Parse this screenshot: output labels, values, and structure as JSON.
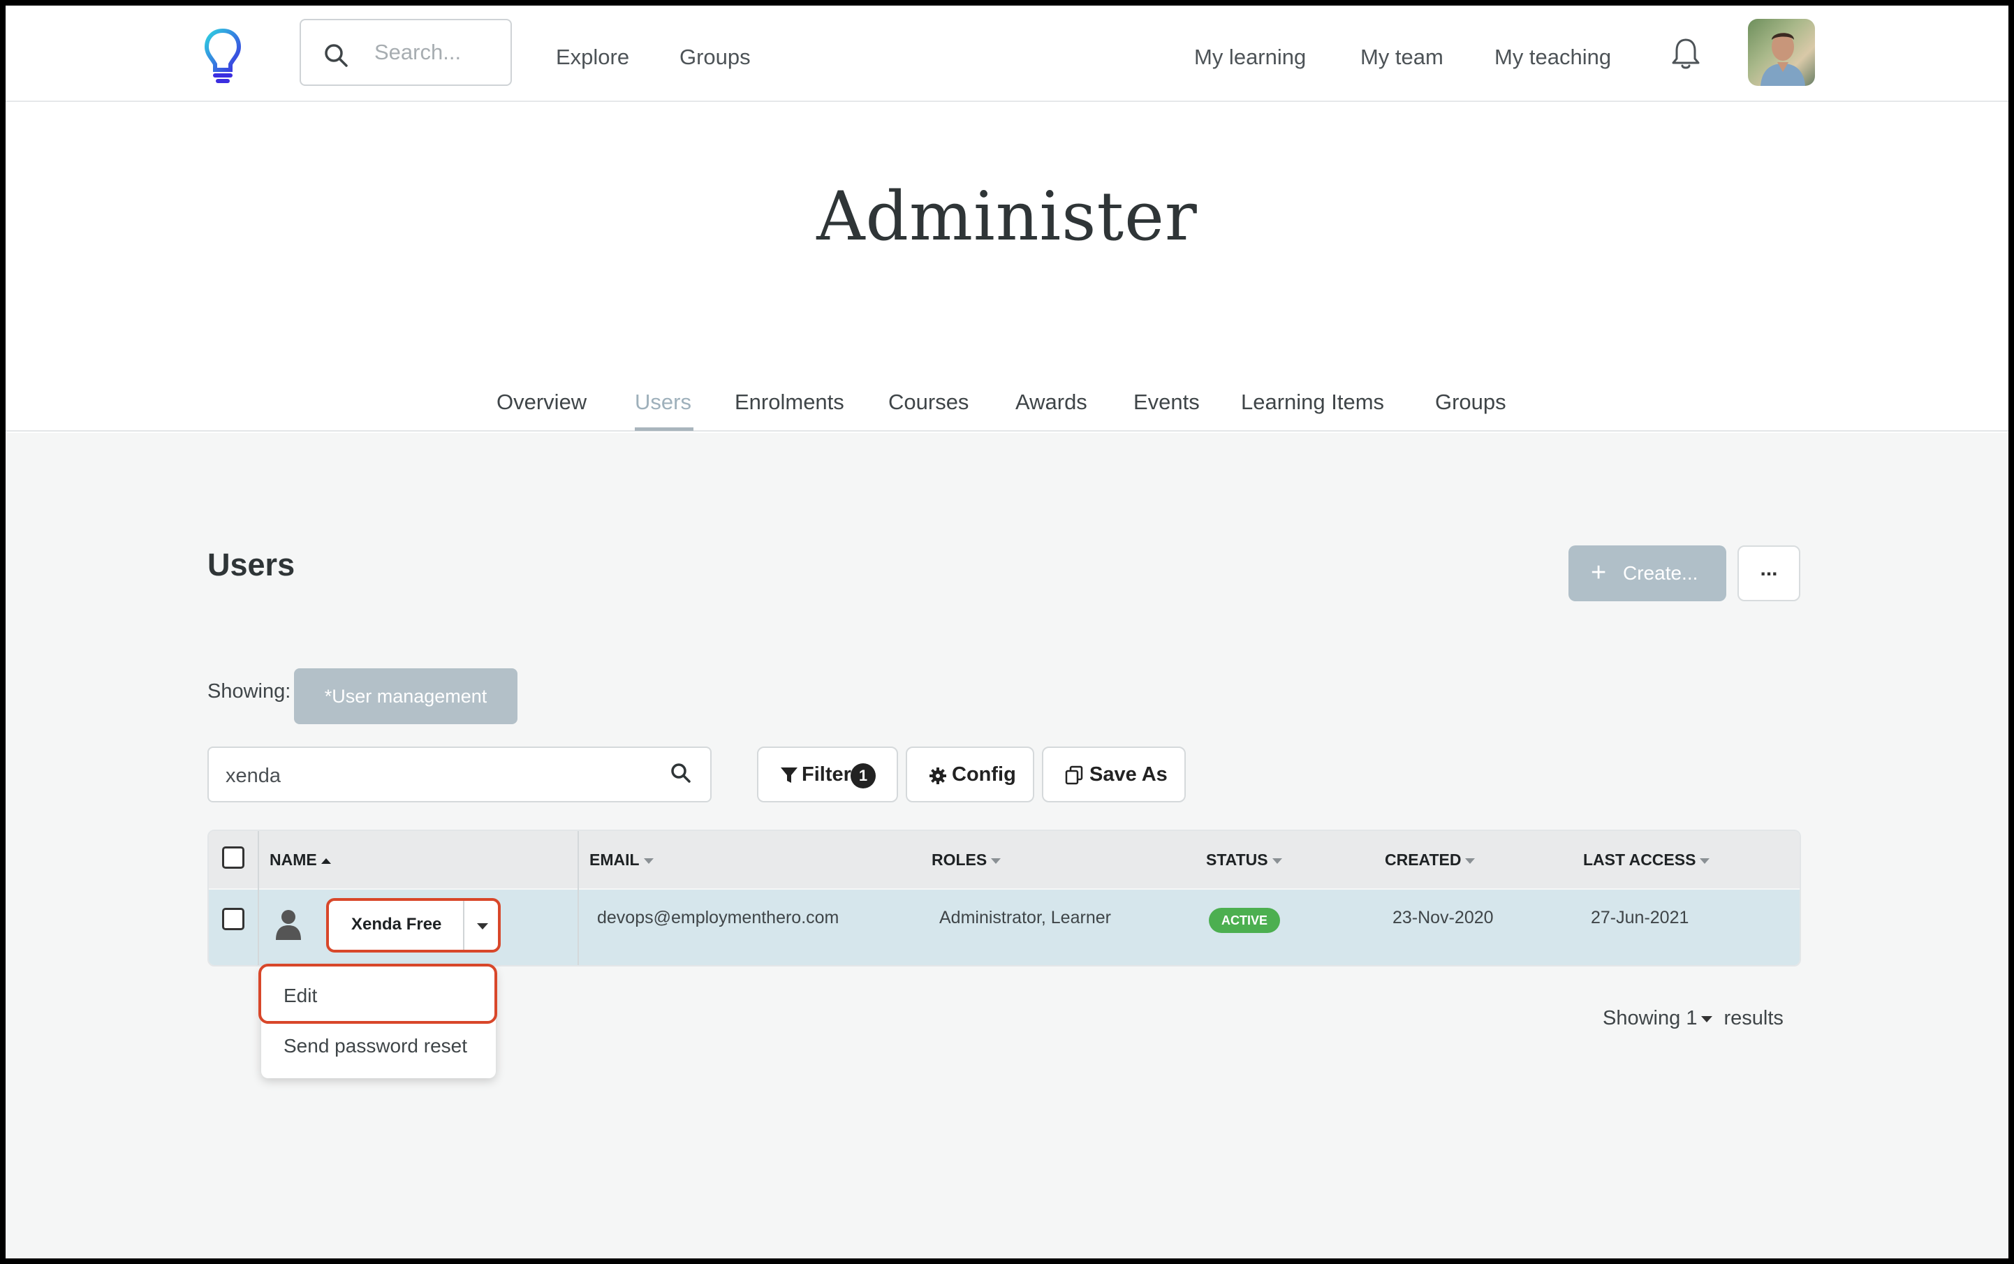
{
  "header": {
    "search_placeholder": "Search...",
    "nav_left": [
      "Explore",
      "Groups"
    ],
    "nav_right": [
      "My learning",
      "My team",
      "My teaching"
    ]
  },
  "page_title": "Administer",
  "tabs": [
    {
      "label": "Overview",
      "active": false
    },
    {
      "label": "Users",
      "active": true
    },
    {
      "label": "Enrolments",
      "active": false
    },
    {
      "label": "Courses",
      "active": false
    },
    {
      "label": "Awards",
      "active": false
    },
    {
      "label": "Events",
      "active": false
    },
    {
      "label": "Learning Items",
      "active": false
    },
    {
      "label": "Groups",
      "active": false
    }
  ],
  "users_section": {
    "title": "Users",
    "create_label": "Create...",
    "more_label": "...",
    "showing_label": "Showing:",
    "view_name": "*User management",
    "search_value": "xenda",
    "filter_label": "Filter",
    "filter_count": "1",
    "config_label": "Config",
    "save_as_label": "Save As"
  },
  "table": {
    "columns": [
      "NAME",
      "EMAIL",
      "ROLES",
      "STATUS",
      "CREATED",
      "LAST ACCESS"
    ],
    "rows": [
      {
        "name": "Xenda Free",
        "email": "devops@employmenthero.com",
        "roles": "Administrator, Learner",
        "status": "ACTIVE",
        "created": "23-Nov-2020",
        "last_access": "27-Jun-2021"
      }
    ]
  },
  "row_menu": {
    "items": [
      "Edit",
      "Send password reset"
    ]
  },
  "results": {
    "prefix": "Showing",
    "count": "1",
    "suffix": "results"
  },
  "colors": {
    "accent_highlight": "#d8472a",
    "status_active": "#4caf50",
    "selected_row": "#d6e6ec"
  }
}
